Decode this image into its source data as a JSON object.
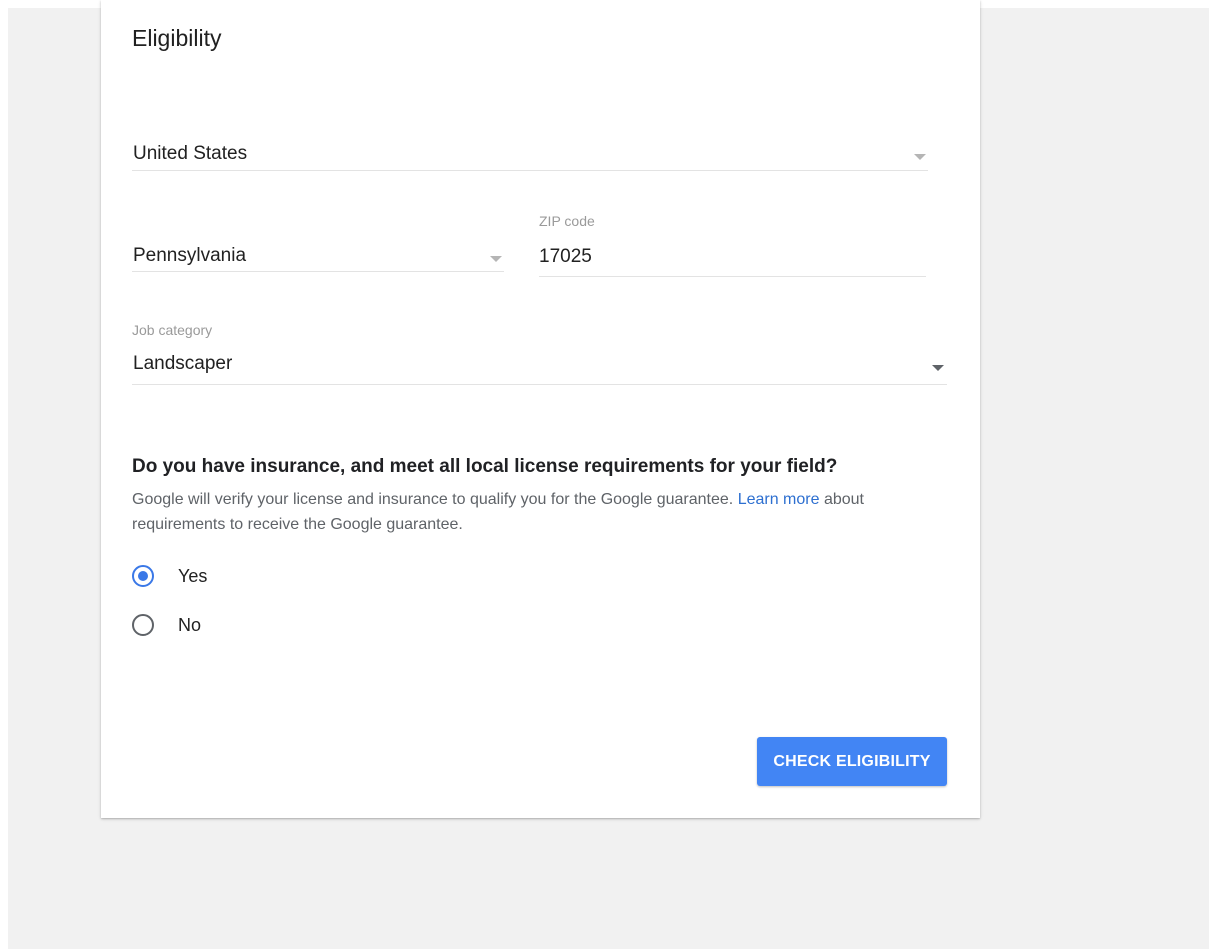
{
  "card": {
    "title": "Eligibility"
  },
  "country_select": {
    "value": "United States"
  },
  "state_select": {
    "value": "Pennsylvania"
  },
  "zip_field": {
    "label": "ZIP code",
    "value": "17025"
  },
  "job_category": {
    "label": "Job category",
    "value": "Landscaper"
  },
  "insurance_question": {
    "heading": "Do you have insurance, and meet all local license requirements for your field?",
    "description_before_link": "Google will verify your license and insurance to qualify you for the Google guarantee. ",
    "link_text": "Learn more",
    "description_after_link": " about requirements to receive the Google guarantee.",
    "options": [
      {
        "label": "Yes",
        "selected": true
      },
      {
        "label": "No",
        "selected": false
      }
    ]
  },
  "submit_button": {
    "label": "CHECK ELIGIBILITY"
  },
  "colors": {
    "accent": "#4285f4",
    "link": "#2d6fd0",
    "page_background": "#f1f1f1"
  },
  "icons": [
    "dropdown-arrow-icon",
    "radio-selected-icon",
    "radio-unselected-icon"
  ]
}
